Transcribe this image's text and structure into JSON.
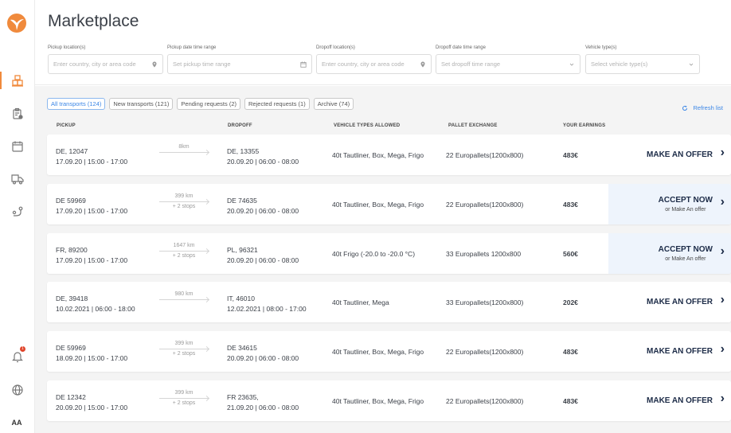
{
  "app": {
    "title": "Marketplace",
    "brand_color": "#f08a3c",
    "accent_color": "#3b86e6"
  },
  "sidebar": {
    "items": [
      {
        "name": "marketplace",
        "icon": "boxes-icon",
        "active": true
      },
      {
        "name": "assignments",
        "icon": "clipboard-check-icon",
        "active": false
      },
      {
        "name": "calendar",
        "icon": "calendar-icon",
        "active": false
      },
      {
        "name": "fleet",
        "icon": "truck-icon",
        "active": false
      },
      {
        "name": "routes",
        "icon": "route-icon",
        "active": false
      }
    ],
    "notifications": {
      "icon": "bell-icon",
      "count": "1"
    },
    "language": {
      "icon": "globe-icon"
    },
    "avatar": {
      "initials": "AA"
    }
  },
  "filters": [
    {
      "label": "Pickup location(s)",
      "placeholder": "Enter country, city or area code",
      "icon": "location-pin-icon"
    },
    {
      "label": "Pickup date time range",
      "placeholder": "Set pickup time range",
      "icon": "calendar-icon"
    },
    {
      "label": "Dropoff location(s)",
      "placeholder": "Enter country, city or area code",
      "icon": "location-pin-icon"
    },
    {
      "label": "Dropoff date time range",
      "placeholder": "Set dropoff time range",
      "icon": "chevron-down-icon"
    },
    {
      "label": "Vehicle type(s)",
      "placeholder": "Select vehicle type(s)",
      "icon": "chevron-down-icon"
    }
  ],
  "tabs": [
    {
      "label": "All transports (124)",
      "active": true
    },
    {
      "label": "New transports (121)",
      "active": false
    },
    {
      "label": "Pending requests (2)",
      "active": false
    },
    {
      "label": "Rejected requests (1)",
      "active": false
    },
    {
      "label": "Archive (74)",
      "active": false
    }
  ],
  "refresh_label": "Refresh list",
  "columns": {
    "pickup": "PICKUP",
    "dropoff": "DROPOFF",
    "vehicle": "VEHICLE TYPES ALLOWED",
    "pallet": "PALLET EXCHANGE",
    "earnings": "YOUR EARNINGS"
  },
  "rows": [
    {
      "pickup_loc": "DE, 12047",
      "pickup_time": "17.09.20 | 15:00 - 17:00",
      "distance": "8km",
      "stops": "",
      "dropoff_loc": "DE, 13355",
      "dropoff_time": "20.09.20 | 06:00 - 08:00",
      "vehicle": "40t Tautliner, Box, Mega, Frigo",
      "pallet": "22 Europallets(1200x800)",
      "earnings": "483€",
      "action": "MAKE AN OFFER",
      "action_sub": "",
      "type": "offer"
    },
    {
      "pickup_loc": "DE 59969",
      "pickup_time": "17.09.20 | 15:00 - 17:00",
      "distance": "399 km",
      "stops": "+ 2 stops",
      "dropoff_loc": "DE 74635",
      "dropoff_time": "20.09.20 | 06:00 - 08:00",
      "vehicle": "40t Tautliner, Box, Mega, Frigo",
      "pallet": "22 Europallets(1200x800)",
      "earnings": "483€",
      "action": "ACCEPT NOW",
      "action_sub": "or Make An offer",
      "type": "accept"
    },
    {
      "pickup_loc": "FR, 89200",
      "pickup_time": "17.09.20 | 15:00 - 17:00",
      "distance": "1647 km",
      "stops": "+ 2 stops",
      "dropoff_loc": "PL, 96321",
      "dropoff_time": "20.09.20 | 06:00 - 08:00",
      "vehicle": "40t Frigo (-20.0 to -20.0 °C)",
      "pallet": "33 Europallets 1200x800",
      "earnings": "560€",
      "action": "ACCEPT NOW",
      "action_sub": "or Make An offer",
      "type": "accept"
    },
    {
      "pickup_loc": "DE, 39418",
      "pickup_time": "10.02.2021 | 06:00 - 18:00",
      "distance": "980 km",
      "stops": "",
      "dropoff_loc": "IT, 46010",
      "dropoff_time": "12.02.2021 | 08:00 - 17:00",
      "vehicle": "40t Tautliner, Mega",
      "pallet": "33 Europallets(1200x800)",
      "earnings": "202€",
      "action": "MAKE AN OFFER",
      "action_sub": "",
      "type": "offer"
    },
    {
      "pickup_loc": "DE 59969",
      "pickup_time": "18.09.20 | 15:00 - 17:00",
      "distance": "399 km",
      "stops": "+ 2 stops",
      "dropoff_loc": "DE 34615",
      "dropoff_time": "20.09.20 | 06:00 - 08:00",
      "vehicle": "40t Tautliner, Box, Mega, Frigo",
      "pallet": "22 Europallets(1200x800)",
      "earnings": "483€",
      "action": "MAKE AN OFFER",
      "action_sub": "",
      "type": "offer"
    },
    {
      "pickup_loc": "DE 12342",
      "pickup_time": "20.09.20 | 15:00 - 17:00",
      "distance": "399 km",
      "stops": "+ 2 stops",
      "dropoff_loc": "FR 23635,",
      "dropoff_time": "21.09.20 | 06:00 - 08:00",
      "vehicle": "40t Tautliner, Box, Mega, Frigo",
      "pallet": "22 Europallets(1200x800)",
      "earnings": "483€",
      "action": "MAKE AN OFFER",
      "action_sub": "",
      "type": "offer"
    }
  ]
}
